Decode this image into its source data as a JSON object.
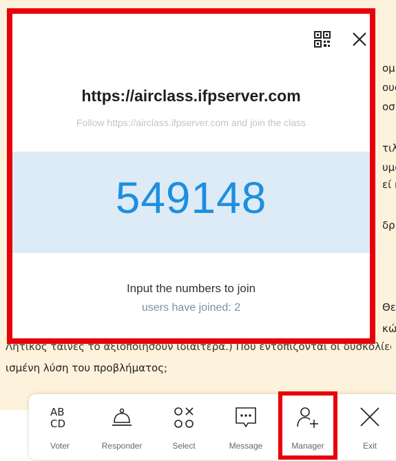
{
  "background_document": {
    "right_fragments": [
      "ομί",
      "ους",
      "οσβ",
      "τιλ",
      "υμφ",
      "εί η",
      "δρ",
      "Θε",
      "κών",
      "ολίες"
    ],
    "line_partial_top": "Λητικός ταίνες το αξιοποιήσουν ιδιαίτερα.) Πού εντοπίζονται οι δυσκολίες",
    "line_bottom": "ισμένη λύση του προβλήματος;"
  },
  "popup": {
    "url_title": "https://airclass.ifpserver.com",
    "follow_text": "Follow https://airclass.ifpserver.com and join the class",
    "code": "549148",
    "input_hint": "Input the numbers to join",
    "joined_text": "users have joined: 2",
    "qr_icon": "qr-code-icon",
    "close_icon": "close-icon"
  },
  "toolbar": {
    "items": [
      {
        "label": "Voter",
        "icon": "voter-abcd-icon"
      },
      {
        "label": "Responder",
        "icon": "bell-icon"
      },
      {
        "label": "Select",
        "icon": "select-shapes-icon"
      },
      {
        "label": "Message",
        "icon": "message-icon"
      },
      {
        "label": "Manager",
        "icon": "add-user-icon"
      },
      {
        "label": "Exit",
        "icon": "exit-x-icon"
      }
    ]
  },
  "colors": {
    "highlight_red": "#e8000b",
    "code_blue": "#1d8fe0",
    "band_blue": "#dcebf6",
    "doc_bg": "#fdf2dc"
  }
}
